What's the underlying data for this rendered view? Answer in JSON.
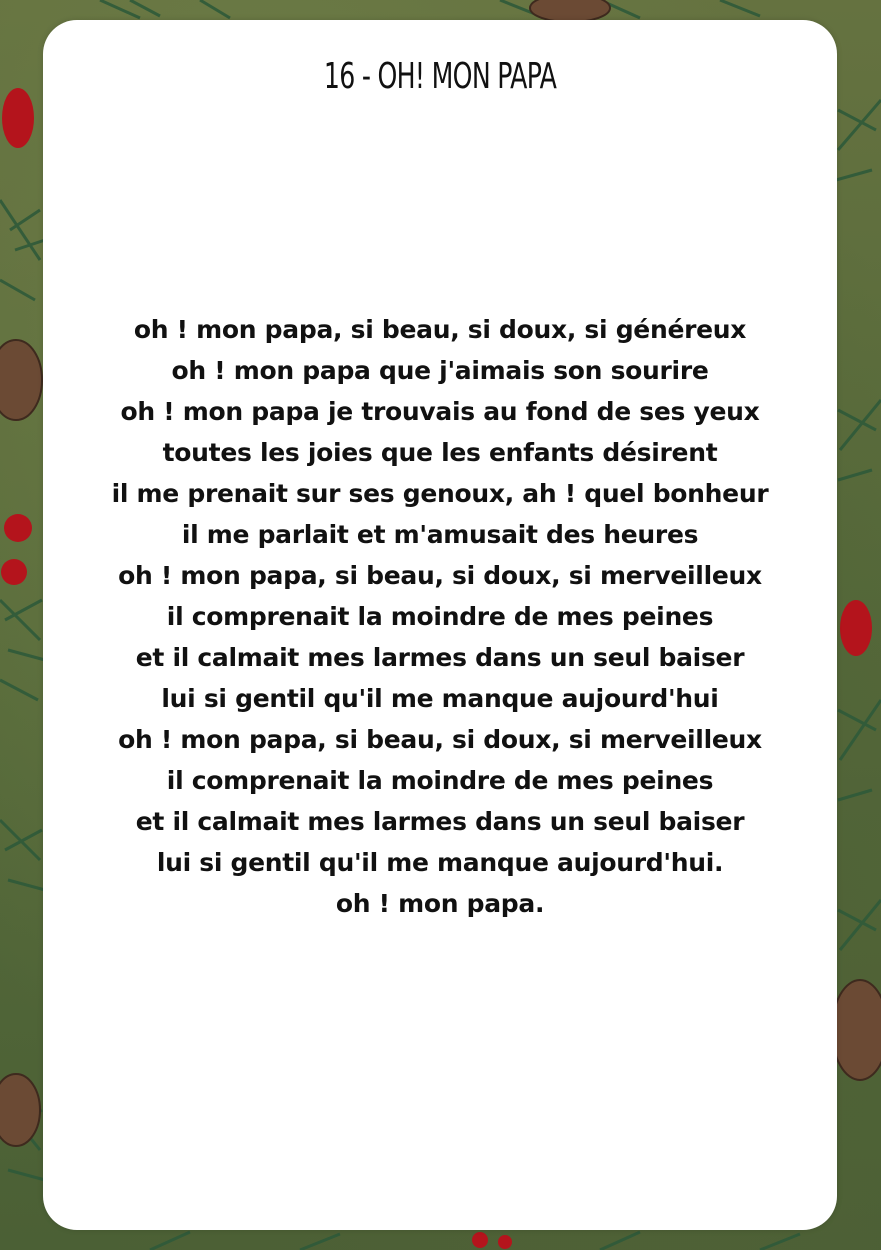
{
  "colors": {
    "background": "#5a6a3c",
    "card": "#ffffff",
    "text": "#111111",
    "berry": "#b4141c",
    "pine": "#2f5a3a"
  },
  "title": "16 - OH! MON PAPA",
  "lyrics": [
    "oh ! mon papa, si beau, si doux, si généreux",
    "oh ! mon papa que j'aimais son sourire",
    "oh ! mon papa je trouvais au fond de ses yeux",
    "toutes les joies que les enfants désirent",
    "il me prenait sur ses genoux, ah ! quel bonheur",
    "il me parlait et m'amusait des heures",
    "oh ! mon papa, si beau, si doux, si merveilleux",
    "il comprenait la moindre de mes peines",
    "et il calmait mes larmes dans un seul baiser",
    "lui si gentil qu'il me manque aujourd'hui",
    "oh ! mon papa, si beau, si doux, si merveilleux",
    "il comprenait la moindre de mes peines",
    "et il calmait mes larmes dans un seul baiser",
    "lui si gentil qu'il me manque aujourd'hui.",
    "oh ! mon papa."
  ],
  "decorations": {
    "icons": [
      "berry-icon",
      "pine-branch-icon",
      "pinecone-icon"
    ]
  }
}
